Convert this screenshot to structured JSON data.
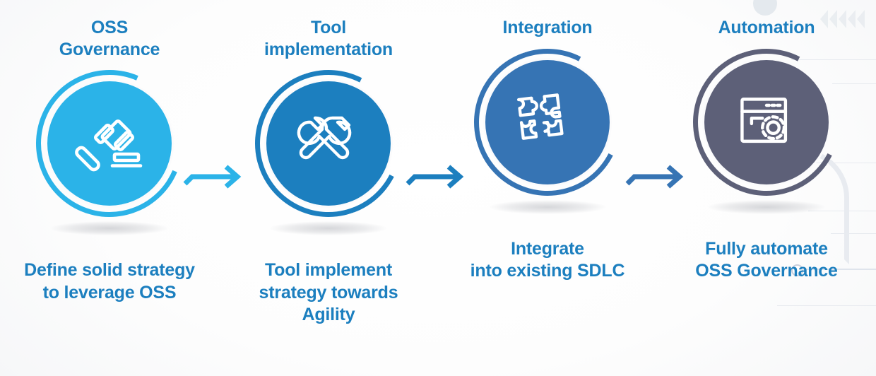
{
  "diagram": {
    "title_color": "#1C7FBF",
    "caption_color": "#1C7FBF",
    "background": "#ffffff",
    "steps": [
      {
        "title_line1": "OSS",
        "title_line2": "Governance",
        "caption_line1": "Define solid strategy",
        "caption_line2": "to leverage OSS",
        "caption_line3": "",
        "icon": "gavel-icon",
        "circle_color": "#2BB3E8",
        "ring_color": "#2BB3E8",
        "arrow_color": "#2BB3E8"
      },
      {
        "title_line1": "Tool",
        "title_line2": "implementation",
        "caption_line1": "Tool implement",
        "caption_line2": "strategy towards",
        "caption_line3": "Agility",
        "icon": "wrench-screwdriver-icon",
        "circle_color": "#1C7FBF",
        "ring_color": "#1C7FBF",
        "arrow_color": "#1C7FBF"
      },
      {
        "title_line1": "Integration",
        "title_line2": "",
        "caption_line1": "Integrate",
        "caption_line2": "into existing SDLC",
        "caption_line3": "",
        "icon": "puzzle-pieces-icon",
        "circle_color": "#3674B4",
        "ring_color": "#3674B4",
        "arrow_color": "#3674B4"
      },
      {
        "title_line1": "Automation",
        "title_line2": "",
        "caption_line1": "Fully automate",
        "caption_line2": "OSS Governance",
        "caption_line3": "",
        "icon": "browser-gear-icon",
        "circle_color": "#5D6078",
        "ring_color": "#5D6078",
        "arrow_color": "#5D6078"
      }
    ],
    "decorations": {
      "chevrons_count": 5,
      "chevron_color": "#dfe5ea",
      "line_color": "#e7eaef"
    }
  }
}
